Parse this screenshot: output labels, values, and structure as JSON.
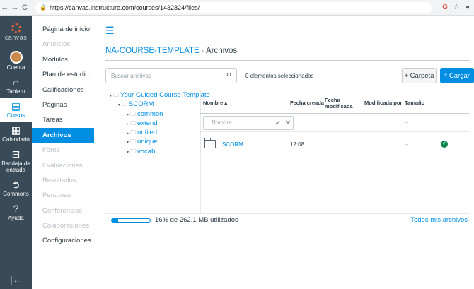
{
  "browser": {
    "back": "←",
    "forward": "→",
    "reload": "C",
    "url": "https://canvas.instructure.com/courses/1432824/files/"
  },
  "global_nav": {
    "logo_text": "canvas",
    "items": [
      {
        "label": "Cuenta",
        "icon": "user-avatar"
      },
      {
        "label": "Tablero",
        "icon": "dashboard-icon",
        "glyph": "⌂"
      },
      {
        "label": "Cursos",
        "icon": "courses-icon",
        "glyph": "▤",
        "active": true
      },
      {
        "label": "Calendario",
        "icon": "calendar-icon",
        "glyph": "▦"
      },
      {
        "label": "Bandeja de entrada",
        "icon": "inbox-icon",
        "glyph": "⊟"
      },
      {
        "label": "Commons",
        "icon": "commons-icon",
        "glyph": "➲"
      },
      {
        "label": "Ayuda",
        "icon": "help-icon",
        "glyph": "?"
      }
    ],
    "collapse_glyph": "|←"
  },
  "course_nav": {
    "items": [
      {
        "label": "Página de inicio",
        "state": "normal"
      },
      {
        "label": "Anuncios",
        "state": "disabled"
      },
      {
        "label": "Módulos",
        "state": "normal"
      },
      {
        "label": "Plan de estudio",
        "state": "normal"
      },
      {
        "label": "Calificaciones",
        "state": "normal"
      },
      {
        "label": "Páginas",
        "state": "normal"
      },
      {
        "label": "Tareas",
        "state": "normal"
      },
      {
        "label": "Archivos",
        "state": "active"
      },
      {
        "label": "Foros",
        "state": "disabled"
      },
      {
        "label": "Evaluaciones",
        "state": "disabled"
      },
      {
        "label": "Resultados",
        "state": "disabled"
      },
      {
        "label": "Personas",
        "state": "disabled"
      },
      {
        "label": "Conferencias",
        "state": "disabled"
      },
      {
        "label": "Colaboraciones",
        "state": "disabled"
      },
      {
        "label": "Configuraciones",
        "state": "normal"
      }
    ]
  },
  "breadcrumb": {
    "course": "NA-COURSE-TEMPLATE",
    "separator": "›",
    "current": "Archivos"
  },
  "toolbar": {
    "search_placeholder": "Buscar archivos",
    "selected_count": "0 elementos seleccionados",
    "add_folder_label": "+ Carpeta",
    "upload_label": "⤒ Cargar"
  },
  "tree": {
    "root": "Your Guided Course Template",
    "scorm": "SCORM",
    "children": [
      "common",
      "extend",
      "unfiled",
      "unique",
      "vocab"
    ]
  },
  "table": {
    "headers": {
      "name": "Nombre ▴",
      "created": "Fecha creada",
      "modified": "Fecha modificada",
      "modified_by": "Modificada por",
      "size": "Tamaño"
    },
    "new_folder_placeholder": "Nombre",
    "new_folder_size": "--",
    "rows": [
      {
        "name": "SCORM",
        "created": "12:08",
        "size": "--",
        "published": true
      }
    ]
  },
  "quota": {
    "percent": 16,
    "text": "16% de 262.1 MB utilizados"
  },
  "all_files_link": "Todos mis archivos",
  "colors": {
    "accent": "#008ee2",
    "nav_bg": "#394b58",
    "published": "#0b874b"
  }
}
